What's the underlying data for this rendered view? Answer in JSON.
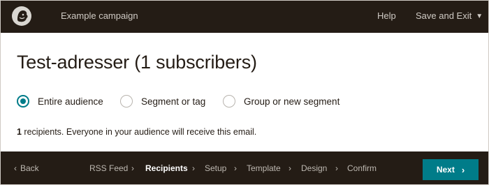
{
  "header": {
    "logo_icon": "mailchimp-freddie-icon",
    "campaign_name": "Example campaign",
    "help_label": "Help",
    "save_exit_label": "Save and Exit",
    "save_exit_caret_icon": "chevron-down-icon"
  },
  "main": {
    "title": "Test-adresser (1 subscribers)",
    "audience_options": [
      {
        "label": "Entire audience",
        "selected": true
      },
      {
        "label": "Segment or tag",
        "selected": false
      },
      {
        "label": "Group or new segment",
        "selected": false
      }
    ],
    "recipient_count": "1",
    "recipient_text": " recipients. Everyone in your audience will receive this email."
  },
  "footer": {
    "back_label": "Back",
    "steps": [
      {
        "label": "RSS Feed",
        "active": false
      },
      {
        "label": "Recipients",
        "active": true
      },
      {
        "label": "Setup",
        "active": false
      },
      {
        "label": "Template",
        "active": false
      },
      {
        "label": "Design",
        "active": false
      },
      {
        "label": "Confirm",
        "active": false
      }
    ],
    "next_label": "Next"
  },
  "colors": {
    "bar_background": "#241c15",
    "accent": "#007c89",
    "page_background": "#ffffff"
  }
}
